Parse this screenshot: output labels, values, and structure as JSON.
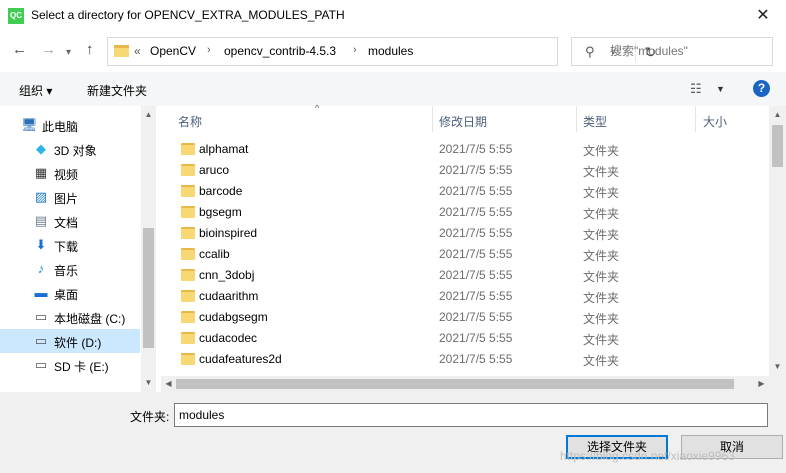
{
  "window": {
    "title": "Select a directory for OPENCV_EXTRA_MODULES_PATH",
    "app_icon_text": "QC",
    "close_glyph": "✕"
  },
  "nav": {
    "back": "←",
    "forward": "→",
    "recent": "▾",
    "up": "↑"
  },
  "address": {
    "lead": "«",
    "crumbs": [
      "OpenCV",
      "opencv_contrib-4.5.3",
      "modules"
    ],
    "separator": "›",
    "dropdown": "∨",
    "refresh": "↻"
  },
  "search": {
    "icon": "⚲",
    "placeholder": "搜索\"modules\""
  },
  "toolbar": {
    "organize": "组织 ▾",
    "new_folder": "新建文件夹",
    "view_icon": "☷",
    "view_dd": "▼",
    "help": "?"
  },
  "sidebar": {
    "items": [
      {
        "label": "此电脑",
        "icon": "🖥",
        "color": "#2a6fb8"
      },
      {
        "label": "3D 对象",
        "icon": "◆",
        "color": "#2bb4e6"
      },
      {
        "label": "视频",
        "icon": "▦",
        "color": "#333333"
      },
      {
        "label": "图片",
        "icon": "▨",
        "color": "#1f7ac4"
      },
      {
        "label": "文档",
        "icon": "▤",
        "color": "#6b7a8c"
      },
      {
        "label": "下载",
        "icon": "⬇",
        "color": "#1a6ed1"
      },
      {
        "label": "音乐",
        "icon": "♪",
        "color": "#1a8ad1"
      },
      {
        "label": "桌面",
        "icon": "▬",
        "color": "#1a6ed1"
      },
      {
        "label": "本地磁盘 (C:)",
        "icon": "▭",
        "color": "#555555"
      },
      {
        "label": "软件 (D:)",
        "icon": "▭",
        "color": "#555555"
      },
      {
        "label": "SD 卡 (E:)",
        "icon": "▭",
        "color": "#555555"
      }
    ],
    "selected_index": 9
  },
  "file_list": {
    "columns": {
      "name": "名称",
      "date": "修改日期",
      "type": "类型",
      "size": "大小"
    },
    "sort_arrow": "^",
    "rows": [
      {
        "name": "alphamat",
        "date": "2021/7/5 5:55",
        "type": "文件夹"
      },
      {
        "name": "aruco",
        "date": "2021/7/5 5:55",
        "type": "文件夹"
      },
      {
        "name": "barcode",
        "date": "2021/7/5 5:55",
        "type": "文件夹"
      },
      {
        "name": "bgsegm",
        "date": "2021/7/5 5:55",
        "type": "文件夹"
      },
      {
        "name": "bioinspired",
        "date": "2021/7/5 5:55",
        "type": "文件夹"
      },
      {
        "name": "ccalib",
        "date": "2021/7/5 5:55",
        "type": "文件夹"
      },
      {
        "name": "cnn_3dobj",
        "date": "2021/7/5 5:55",
        "type": "文件夹"
      },
      {
        "name": "cudaarithm",
        "date": "2021/7/5 5:55",
        "type": "文件夹"
      },
      {
        "name": "cudabgsegm",
        "date": "2021/7/5 5:55",
        "type": "文件夹"
      },
      {
        "name": "cudacodec",
        "date": "2021/7/5 5:55",
        "type": "文件夹"
      },
      {
        "name": "cudafeatures2d",
        "date": "2021/7/5 5:55",
        "type": "文件夹"
      }
    ]
  },
  "scroll_arrows": {
    "up": "▲",
    "down": "▼",
    "left": "◀",
    "right": "▶"
  },
  "footer": {
    "folder_label": "文件夹:",
    "folder_value": "modules",
    "select_button": "选择文件夹",
    "cancel_button": "取消",
    "watermark": "https://blog.csdn.net/xiaoxie9963"
  }
}
